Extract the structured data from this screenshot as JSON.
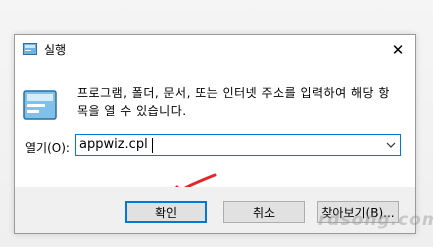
{
  "window": {
    "title": "실행",
    "close_icon": "close-icon"
  },
  "content": {
    "description_line1": "프로그램, 폴더, 문서, 또는 인터넷 주소를 입력하여 해당 항",
    "description_line2": "목을 열 수 있습니다.",
    "open_label": "열기(O):",
    "input_value": "appwiz.cpl"
  },
  "buttons": {
    "ok": "확인",
    "cancel": "취소",
    "browse": "찾아보기(B)..."
  },
  "watermark": "rdsong.com",
  "colors": {
    "accent": "#0078d7",
    "annotation": "#e5262b"
  }
}
